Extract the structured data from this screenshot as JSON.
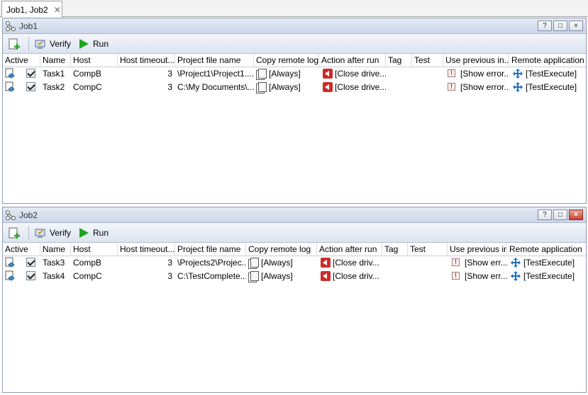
{
  "doc_tab": {
    "label": "Job1, Job2",
    "close": "✕"
  },
  "toolbar": {
    "verify": "Verify",
    "run": "Run"
  },
  "columns": [
    "Active",
    "Name",
    "Host",
    "Host timeout...",
    "Project file name",
    "Copy remote log",
    "Action after run",
    "Tag",
    "Test",
    "Use previous in...",
    "Remote application"
  ],
  "job1": {
    "title": "Job1",
    "window_buttons": [
      "?",
      "□",
      "×"
    ],
    "rows": [
      {
        "name": "Task1",
        "host": "CompB",
        "timeout": "3",
        "project": "\\Project1\\Project1....",
        "log": "[Always]",
        "action": "[Close drive...",
        "tag": "",
        "test": "",
        "use_prev": "[Show error...",
        "remote": "[TestExecute]"
      },
      {
        "name": "Task2",
        "host": "CompC",
        "timeout": "3",
        "project": "C:\\My Documents\\...",
        "log": "[Always]",
        "action": "[Close drive...",
        "tag": "",
        "test": "",
        "use_prev": "[Show error...",
        "remote": "[TestExecute]"
      }
    ]
  },
  "job2": {
    "title": "Job2",
    "window_buttons": [
      "?",
      "□",
      "×"
    ],
    "rows": [
      {
        "name": "Task3",
        "host": "CompB",
        "timeout": "3",
        "project": "\\Projects2\\Projec...",
        "log": "[Always]",
        "action": "[Close driv...",
        "tag": "",
        "test": "",
        "use_prev": "[Show err...",
        "remote": "[TestExecute]"
      },
      {
        "name": "Task4",
        "host": "CompC",
        "timeout": "3",
        "project": "C:\\TestComplete...",
        "log": "[Always]",
        "action": "[Close driv...",
        "tag": "",
        "test": "",
        "use_prev": "[Show err...",
        "remote": "[TestExecute]"
      }
    ]
  }
}
